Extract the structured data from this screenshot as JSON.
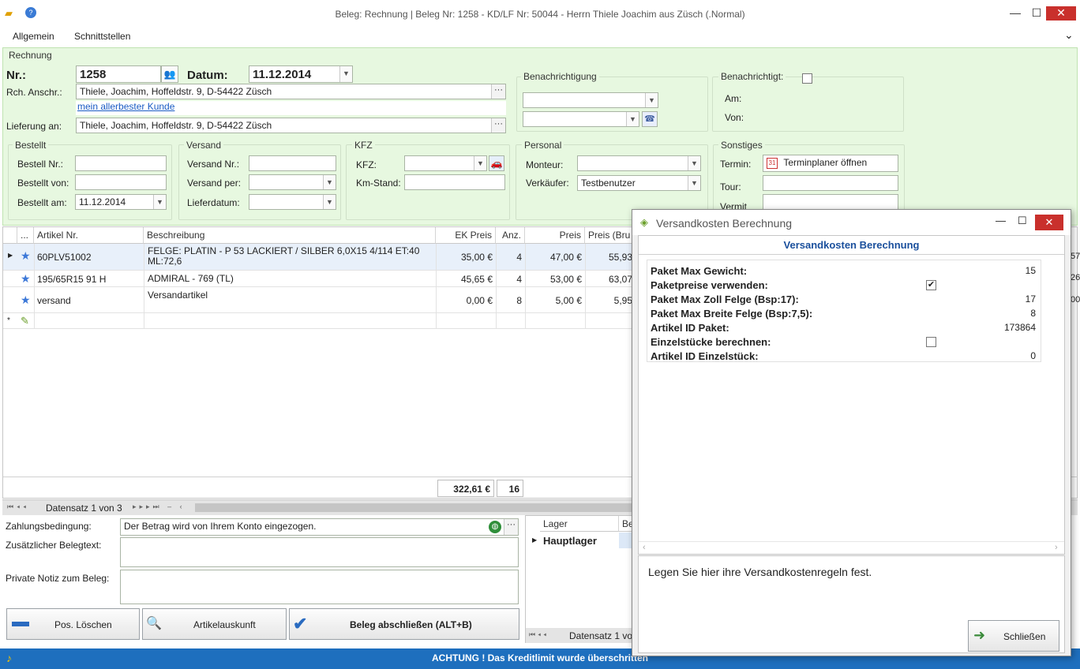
{
  "window": {
    "title": "Beleg: Rechnung | Beleg Nr: 1258 -  KD/LF Nr: 50044 - Herrn  Thiele Joachim aus Züsch (.Normal)",
    "minimize": "—",
    "maximize": "☐",
    "close": "✕"
  },
  "menu": {
    "items": [
      "Allgemein",
      "Schnittstellen"
    ],
    "collapse": "⌄"
  },
  "rechnung": {
    "legend": "Rechnung",
    "nr_label": "Nr.:",
    "nr_value": "1258",
    "datum_label": "Datum:",
    "datum_value": "11.12.2014",
    "anschr_label": "Rch. Anschr.:",
    "anschr_value": "Thiele,  Joachim,  Hoffeldstr. 9,  D-54422 Züsch",
    "kunde_link": "mein allerbester Kunde",
    "lieferung_label": "Lieferung an:",
    "lieferung_value": "Thiele,  Joachim,  Hoffeldstr. 9,  D-54422 Züsch"
  },
  "benachrichtigung": {
    "legend": "Benachrichtigung"
  },
  "benachrichtigt": {
    "legend": "Benachrichtigt:",
    "am": "Am:",
    "von": "Von:",
    "checked": false
  },
  "bestellt": {
    "legend": "Bestellt",
    "nr_label": "Bestell Nr.:",
    "von_label": "Bestellt von:",
    "am_label": "Bestellt am:",
    "am_value": "11.12.2014"
  },
  "versand": {
    "legend": "Versand",
    "nr_label": "Versand Nr.:",
    "per_label": "Versand per:",
    "datum_label": "Lieferdatum:"
  },
  "kfz": {
    "legend": "KFZ",
    "kfz_label": "KFZ:",
    "km_label": "Km-Stand:"
  },
  "personal": {
    "legend": "Personal",
    "monteur_label": "Monteur:",
    "verkaeufer_label": "Verkäufer:",
    "verkaeufer_value": "Testbenutzer"
  },
  "sonstiges": {
    "legend": "Sonstiges",
    "termin_label": "Termin:",
    "termin_button": "Terminplaner öffnen",
    "tour_label": "Tour:",
    "vermit_label": "Vermit"
  },
  "grid": {
    "headers": [
      "...",
      "Artikel Nr.",
      "Beschreibung",
      "EK Preis",
      "Anz.",
      "Preis",
      "Preis (Bru"
    ],
    "rows": [
      {
        "artikel": "60PLV51002",
        "beschreibung": "FELGE: PLATIN - P 53 LACKIERT / SILBER 6,0X15 4/114 ET:40 ML:72,6",
        "ek": "35,00 €",
        "anz": "4",
        "preis": "47,00 €",
        "brutto": "55,93"
      },
      {
        "artikel": "195/65R15 91 H",
        "beschreibung": "ADMIRAL - 769 (TL)",
        "ek": "45,65 €",
        "anz": "4",
        "preis": "53,00 €",
        "brutto": "63,07"
      },
      {
        "artikel": "versand",
        "beschreibung": "Versandartikel",
        "ek": "0,00 €",
        "anz": "8",
        "preis": "5,00 €",
        "brutto": "5,95"
      }
    ],
    "sum_ek": "322,61 €",
    "sum_anz": "16",
    "navigator": "Datensatz 1 von 3",
    "right_edge": [
      "57",
      "26",
      "00"
    ]
  },
  "bottom": {
    "zahlung_label": "Zahlungsbedingung:",
    "zahlung_value": "Der Betrag wird von Ihrem Konto eingezogen.",
    "zusatz_label": "Zusätzlicher Belegtext:",
    "notiz_label": "Private Notiz zum Beleg:",
    "btn_loeschen": "Pos. Löschen",
    "btn_auskunft": "Artikelauskunft",
    "btn_abschliessen": "Beleg abschließen (ALT+B)",
    "lager_header": "Lager",
    "lager_header2": "Be",
    "lager_row": "Hauptlager",
    "lager_nav": "Datensatz 1 vo"
  },
  "status": {
    "text": "ACHTUNG ! Das Kreditlimit wurde überschritten"
  },
  "dialog": {
    "title": "Versandkosten Berechnung",
    "heading": "Versandkosten Berechnung",
    "props": [
      {
        "label": "Paket Max Gewicht:",
        "value": "15"
      },
      {
        "label": "Paketpreise verwenden:",
        "checkbox": true
      },
      {
        "label": "Paket Max Zoll Felge (Bsp:17):",
        "value": "17"
      },
      {
        "label": "Paket Max Breite Felge (Bsp:7,5):",
        "value": "8"
      },
      {
        "label": "Artikel ID Paket:",
        "value": "173864"
      },
      {
        "label": "Einzelstücke berechnen:",
        "checkbox": false
      },
      {
        "label": "Artikel ID Einzelstück:",
        "value": "0"
      }
    ],
    "description": "Legen Sie hier ihre Versandkostenregeln fest.",
    "close_button": "Schließen"
  }
}
